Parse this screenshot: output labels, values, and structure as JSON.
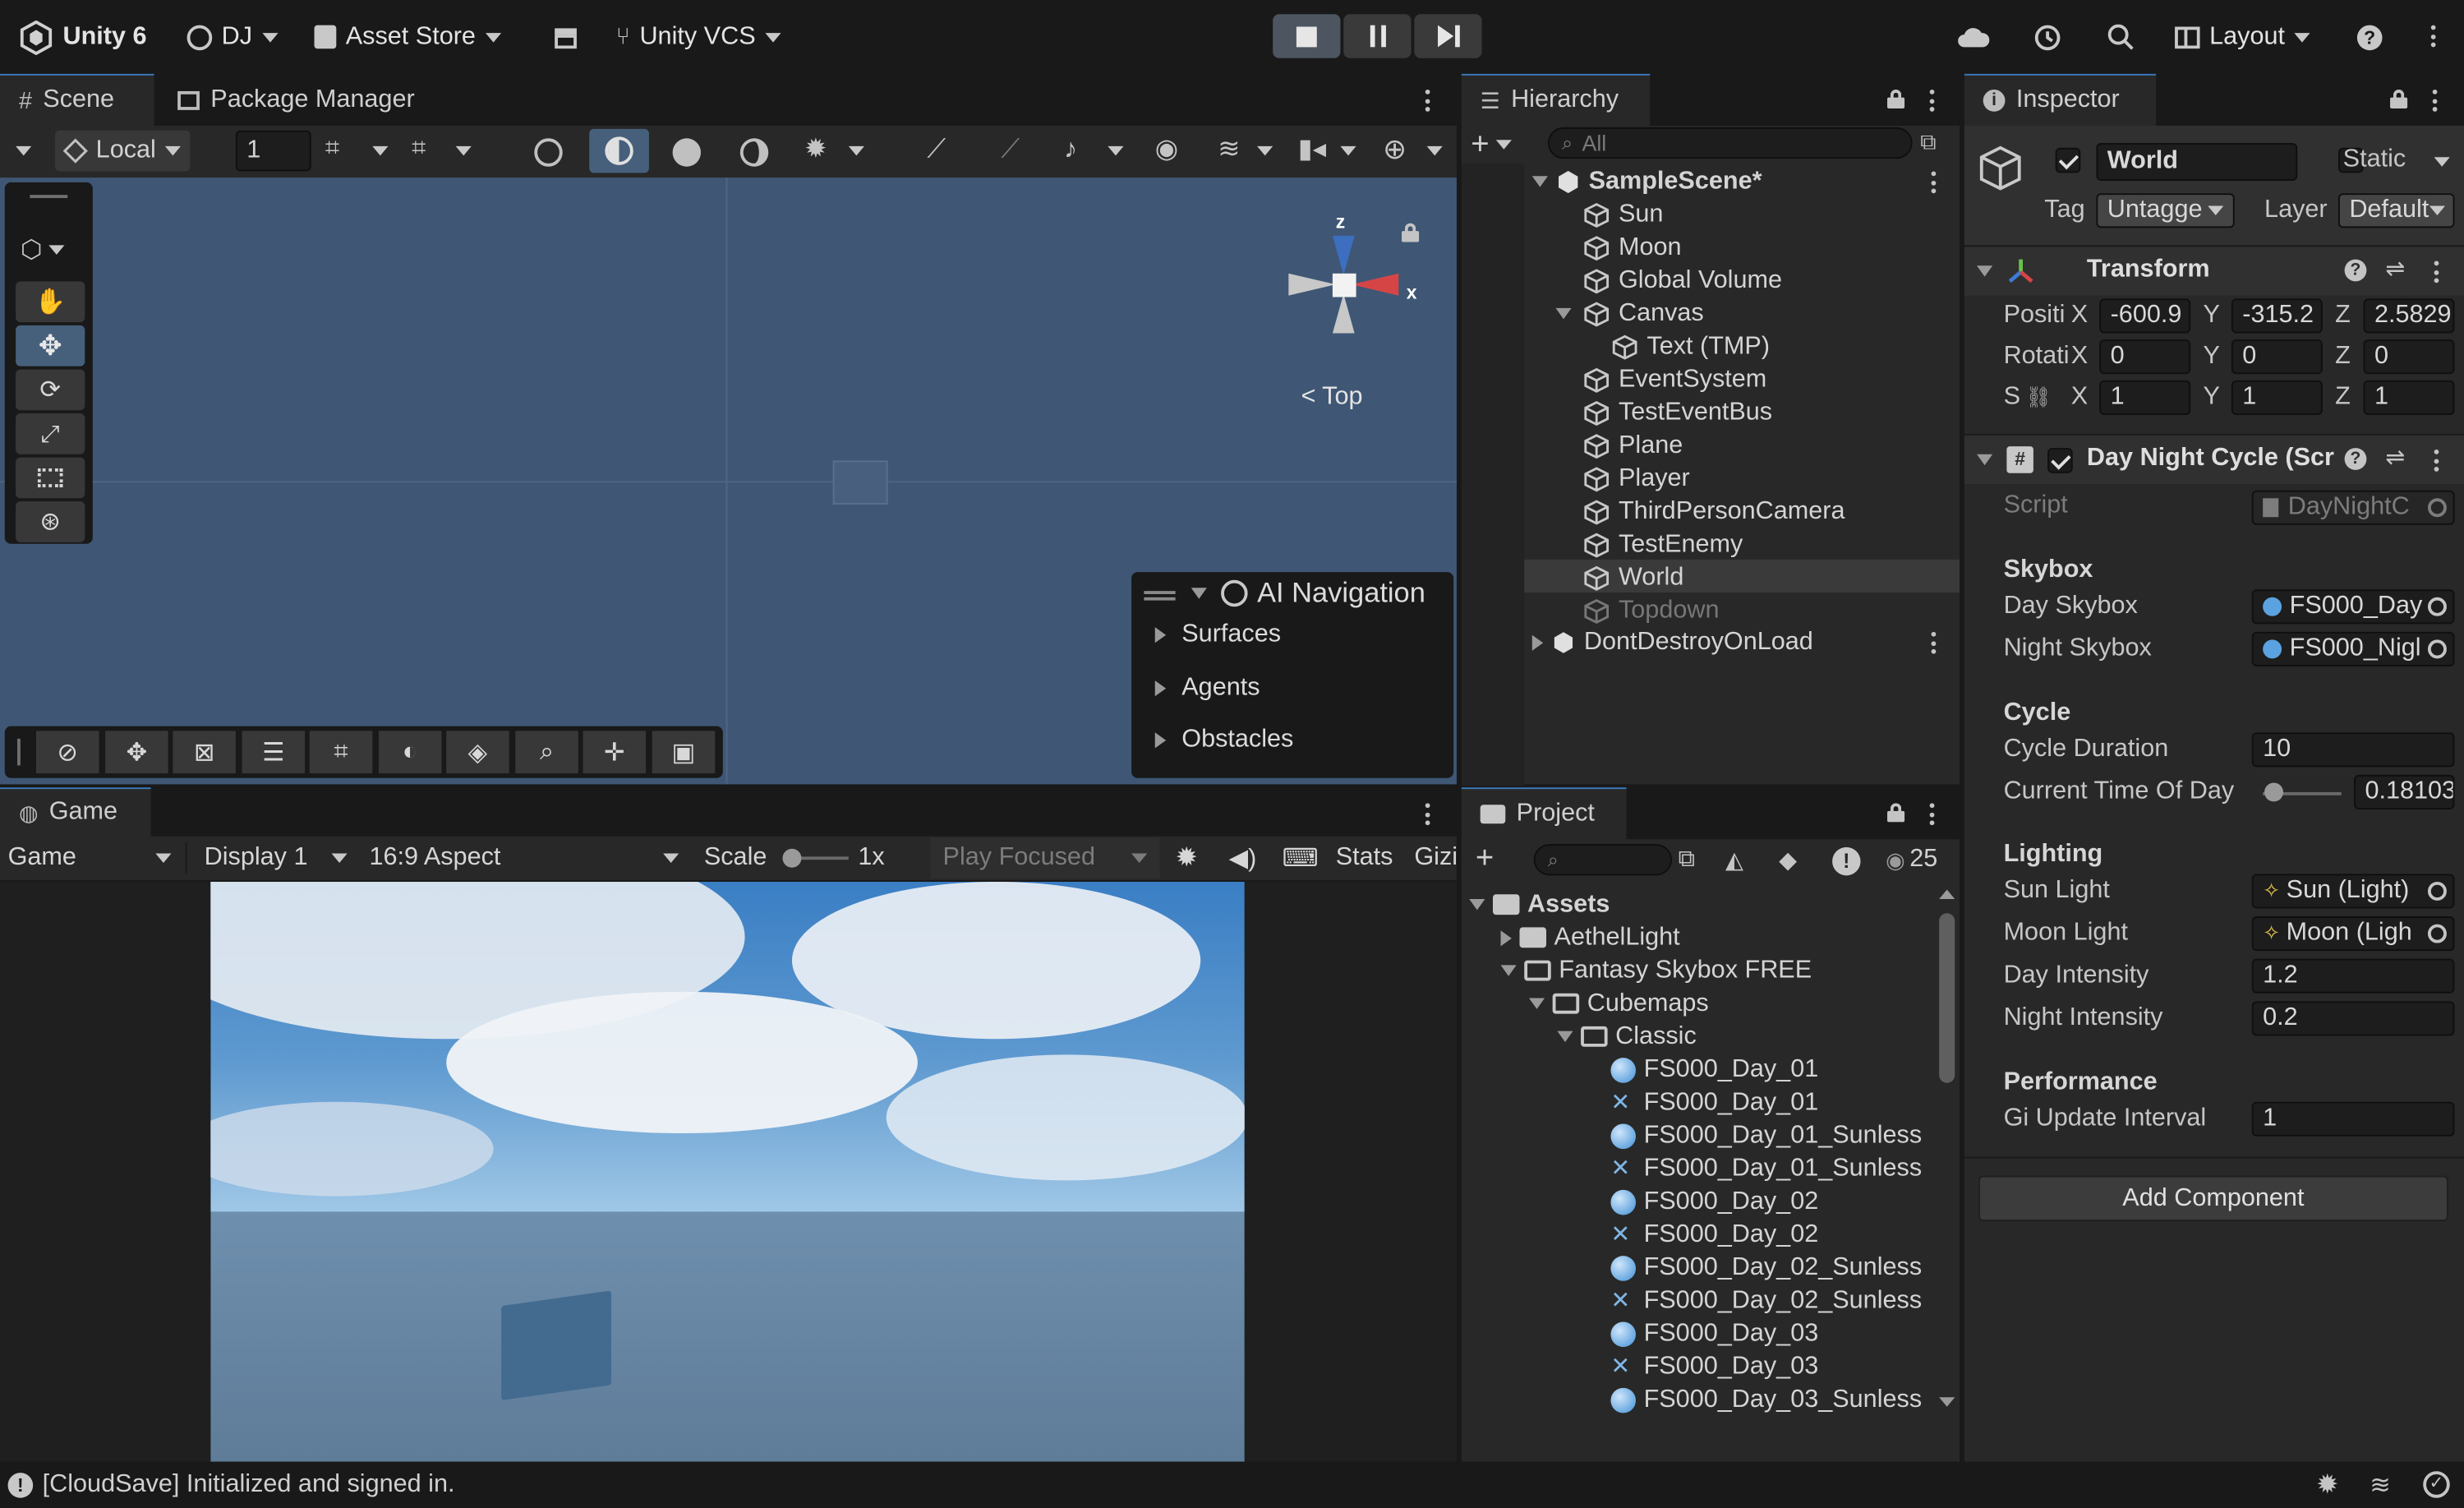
{
  "topbar": {
    "app_label": "Unity 6",
    "account_label": "DJ",
    "asset_store_label": "Asset Store",
    "vcs_label": "Unity VCS",
    "layout_label": "Layout"
  },
  "scene_panel": {
    "tabs": [
      "Scene",
      "Package Manager"
    ],
    "pivot_rotation": "Local",
    "grid_snap_value": "1",
    "gizmo_view_label": "Top",
    "gizmo_axes": {
      "x": "x",
      "z": "z"
    }
  },
  "ai_navigation": {
    "title": "AI Navigation",
    "items": [
      "Surfaces",
      "Agents",
      "Obstacles"
    ]
  },
  "game_panel": {
    "tab": "Game",
    "view_select": "Game",
    "display_select": "Display 1",
    "aspect_select": "16:9 Aspect",
    "scale_label": "Scale",
    "scale_value": "1x",
    "play_mode": "Play Focused",
    "stats_label": "Stats",
    "gizmos_label": "Gizi"
  },
  "hierarchy": {
    "tab": "Hierarchy",
    "search_placeholder": "All",
    "scene_name": "SampleScene*",
    "items": [
      "Sun",
      "Moon",
      "Global Volume",
      "Canvas",
      "Text (TMP)",
      "EventSystem",
      "TestEventBus",
      "Plane",
      "Player",
      "ThirdPersonCamera",
      "TestEnemy",
      "World",
      "Topdown"
    ],
    "dont_destroy": "DontDestroyOnLoad"
  },
  "project": {
    "tab": "Project",
    "visible_count": "25",
    "root": "Assets",
    "folders": [
      "AethelLight",
      "Fantasy Skybox FREE",
      "Cubemaps",
      "Classic"
    ],
    "files": [
      {
        "name": "FS000_Day_01",
        "kind": "material"
      },
      {
        "name": "FS000_Day_01",
        "kind": "texture"
      },
      {
        "name": "FS000_Day_01_Sunless",
        "kind": "material"
      },
      {
        "name": "FS000_Day_01_Sunless",
        "kind": "texture"
      },
      {
        "name": "FS000_Day_02",
        "kind": "material"
      },
      {
        "name": "FS000_Day_02",
        "kind": "texture"
      },
      {
        "name": "FS000_Day_02_Sunless",
        "kind": "material"
      },
      {
        "name": "FS000_Day_02_Sunless",
        "kind": "texture"
      },
      {
        "name": "FS000_Day_03",
        "kind": "material"
      },
      {
        "name": "FS000_Day_03",
        "kind": "texture"
      },
      {
        "name": "FS000_Day_03_Sunless",
        "kind": "material"
      }
    ]
  },
  "inspector": {
    "tab": "Inspector",
    "object_name": "World",
    "static_label": "Static",
    "tag_label": "Tag",
    "tag_value": "Untagge",
    "layer_label": "Layer",
    "layer_value": "Default",
    "transform": {
      "title": "Transform",
      "position_label": "Positi",
      "rotation_label": "Rotati",
      "scale_label": "S",
      "position": {
        "x": "-600.9",
        "y": "-315.2",
        "z": "2.5829"
      },
      "rotation": {
        "x": "0",
        "y": "0",
        "z": "0"
      },
      "scale": {
        "x": "1",
        "y": "1",
        "z": "1"
      }
    },
    "script_component": {
      "title": "Day Night Cycle (Scr",
      "script_label": "Script",
      "script_value": "DayNightC",
      "skybox_header": "Skybox",
      "day_skybox_label": "Day Skybox",
      "day_skybox_value": "FS000_Day",
      "night_skybox_label": "Night Skybox",
      "night_skybox_value": "FS000_Nigl",
      "cycle_header": "Cycle",
      "cycle_duration_label": "Cycle Duration",
      "cycle_duration_value": "10",
      "current_time_label": "Current Time Of Day",
      "current_time_value": "0.18103",
      "lighting_header": "Lighting",
      "sun_light_label": "Sun Light",
      "sun_light_value": "Sun (Light)",
      "moon_light_label": "Moon Light",
      "moon_light_value": "Moon (Ligh",
      "day_intensity_label": "Day Intensity",
      "day_intensity_value": "1.2",
      "night_intensity_label": "Night Intensity",
      "night_intensity_value": "0.2",
      "performance_header": "Performance",
      "gi_interval_label": "Gi Update Interval",
      "gi_interval_value": "1"
    },
    "add_component": "Add Component"
  },
  "status": {
    "message": "[CloudSave] Initialized and signed in."
  },
  "colors": {
    "accent": "#3a79bb",
    "scene_bg": "#3f5775",
    "panel_bg": "#282828",
    "toolbar_bg": "#191919"
  }
}
